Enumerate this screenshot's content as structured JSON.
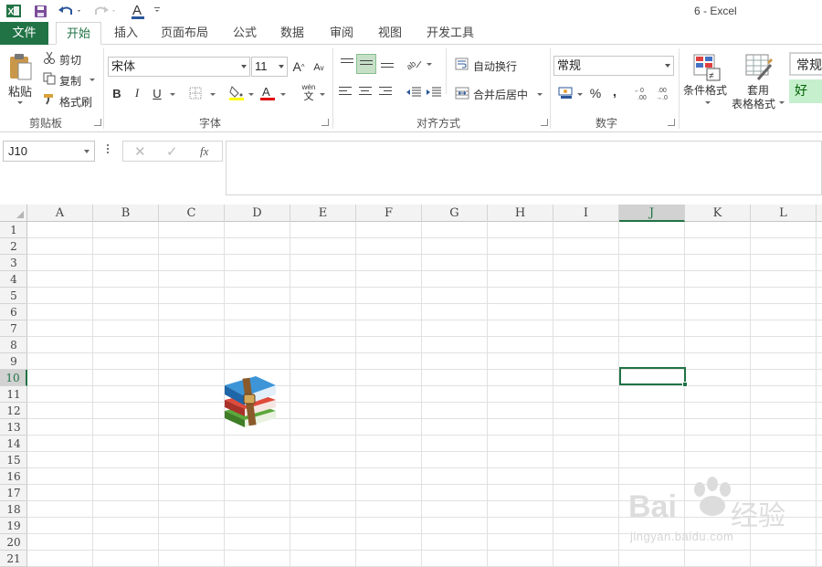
{
  "title_bar": {
    "title": "6 - Excel",
    "font_color_letter": "A"
  },
  "tabs": [
    {
      "label": "文件"
    },
    {
      "label": "开始"
    },
    {
      "label": "插入"
    },
    {
      "label": "页面布局"
    },
    {
      "label": "公式"
    },
    {
      "label": "数据"
    },
    {
      "label": "审阅"
    },
    {
      "label": "视图"
    },
    {
      "label": "开发工具"
    }
  ],
  "clipboard": {
    "paste": "粘贴",
    "cut": "剪切",
    "copy": "复制",
    "format_painter": "格式刷",
    "label": "剪贴板"
  },
  "font": {
    "name": "宋体",
    "size": "11",
    "bold": "B",
    "italic": "I",
    "underline": "U",
    "phonetic": "wén",
    "phonetic_char": "文",
    "label": "字体",
    "grow": "A",
    "shrink": "A",
    "font_color_letter": "A"
  },
  "alignment": {
    "wrap_text": "自动换行",
    "merge_center": "合并后居中",
    "label": "对齐方式"
  },
  "number": {
    "format": "常规",
    "percent": "%",
    "comma": ",",
    "label": "数字"
  },
  "styles": {
    "conditional_format": "条件格式",
    "table_format_1": "套用",
    "table_format_2": "表格格式",
    "normal": "常规",
    "good": "好"
  },
  "formula_bar": {
    "name_box": "J10",
    "fx": "fx"
  },
  "grid": {
    "columns": [
      "A",
      "B",
      "C",
      "D",
      "E",
      "F",
      "G",
      "H",
      "I",
      "J",
      "K",
      "L"
    ],
    "rows": [
      "1",
      "2",
      "3",
      "4",
      "5",
      "6",
      "7",
      "8",
      "9",
      "10",
      "11",
      "12",
      "13",
      "14",
      "15",
      "16",
      "17",
      "18",
      "19",
      "20",
      "21"
    ],
    "selected_column": "J",
    "selected_row": "10"
  },
  "watermark": {
    "brand": "Bai",
    "brand_cn": "经验",
    "url": "jingyan.baidu.com"
  },
  "colors": {
    "excel_green": "#217346",
    "header_bg": "#f3f3f3",
    "gridline": "#e1e1e1"
  }
}
